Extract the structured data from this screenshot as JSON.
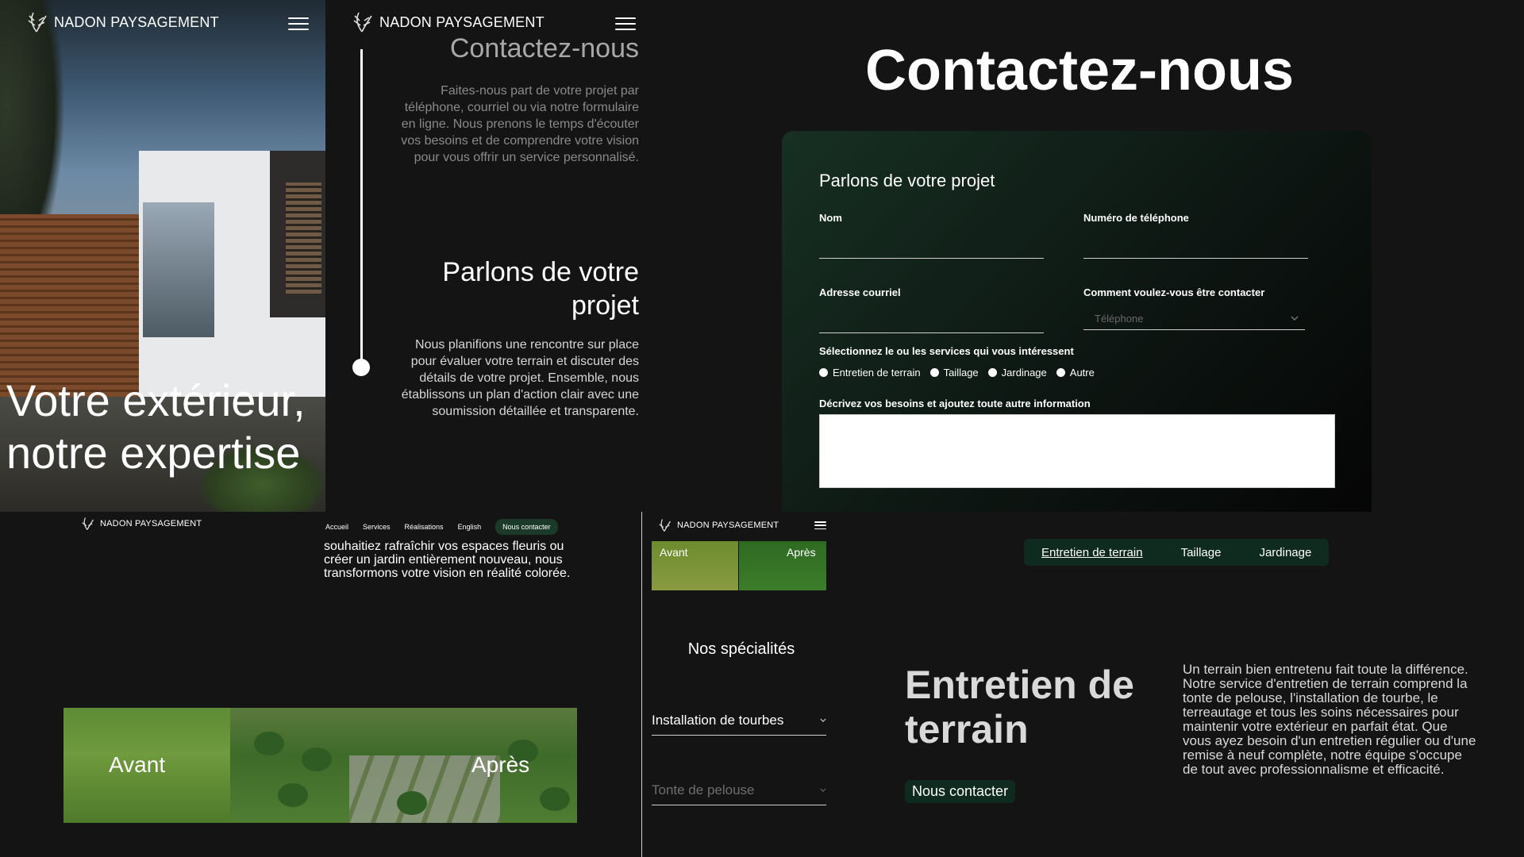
{
  "brand": {
    "name": "NADON PAYSAGEMENT"
  },
  "colors": {
    "accent_green": "#0f2a1f",
    "background": "#141414",
    "text": "#ffffff"
  },
  "icons": {
    "logo": "leaf-emblem-icon",
    "menu": "hamburger-icon",
    "chevron": "chevron-down-icon"
  },
  "hero": {
    "title": "Votre extérieur, notre expertise"
  },
  "timeline": {
    "contact_heading": "Contactez-nous",
    "contact_text": "Faites-nous part de votre projet par téléphone, courriel ou via notre formulaire en ligne. Nous prenons le temps d'écouter vos besoins et de comprendre votre vision pour vous offrir un service personnalisé.",
    "project_heading": "Parlons de votre projet",
    "project_text": "Nous planifions une rencontre sur place pour évaluer votre terrain et discuter des détails de votre projet. Ensemble, nous établissons un plan d'action clair avec une soumission détaillée et transparente."
  },
  "contact_form": {
    "page_title": "Contactez-nous",
    "card_title": "Parlons de votre projet",
    "name_label": "Nom",
    "phone_label": "Numéro de téléphone",
    "email_label": "Adresse courriel",
    "contact_method_label": "Comment voulez-vous être contacter",
    "contact_method_value": "Téléphone",
    "services_label": "Sélectionnez le ou les services qui vous intéressent",
    "services": [
      "Entretien de terrain",
      "Taillage",
      "Jardinage",
      "Autre"
    ],
    "description_label": "Décrivez vos besoins et ajoutez toute autre information"
  },
  "desktop_nav": {
    "items": [
      "Accueil",
      "Services",
      "Réalisations",
      "English"
    ],
    "cta": "Nous contacter"
  },
  "desktop_section": {
    "paragraph": "souhaitiez rafraîchir vos espaces fleuris ou créer un jardin entièrement nouveau, nous transformons votre vision en réalité colorée.",
    "before_label": "Avant",
    "after_label": "Après"
  },
  "mobile": {
    "before_label": "Avant",
    "after_label": "Après",
    "specialties_title": "Nos spécialités",
    "accordion": [
      "Installation de tourbes",
      "Tonte de pelouse"
    ]
  },
  "services_tabs": {
    "tabs": [
      "Entretien de terrain",
      "Taillage",
      "Jardinage"
    ],
    "active_index": 0,
    "heading": "Entretien de terrain",
    "cta": "Nous contacter",
    "paragraph": "Un terrain bien entretenu fait toute la différence. Notre service d'entretien de terrain comprend la tonte de pelouse, l'installation de tourbe, le terreautage et tous les soins nécessaires pour maintenir votre extérieur en parfait état. Que vous ayez besoin d'un entretien régulier ou d'une remise à neuf complète, notre équipe s'occupe de tout avec professionnalisme et efficacité."
  }
}
